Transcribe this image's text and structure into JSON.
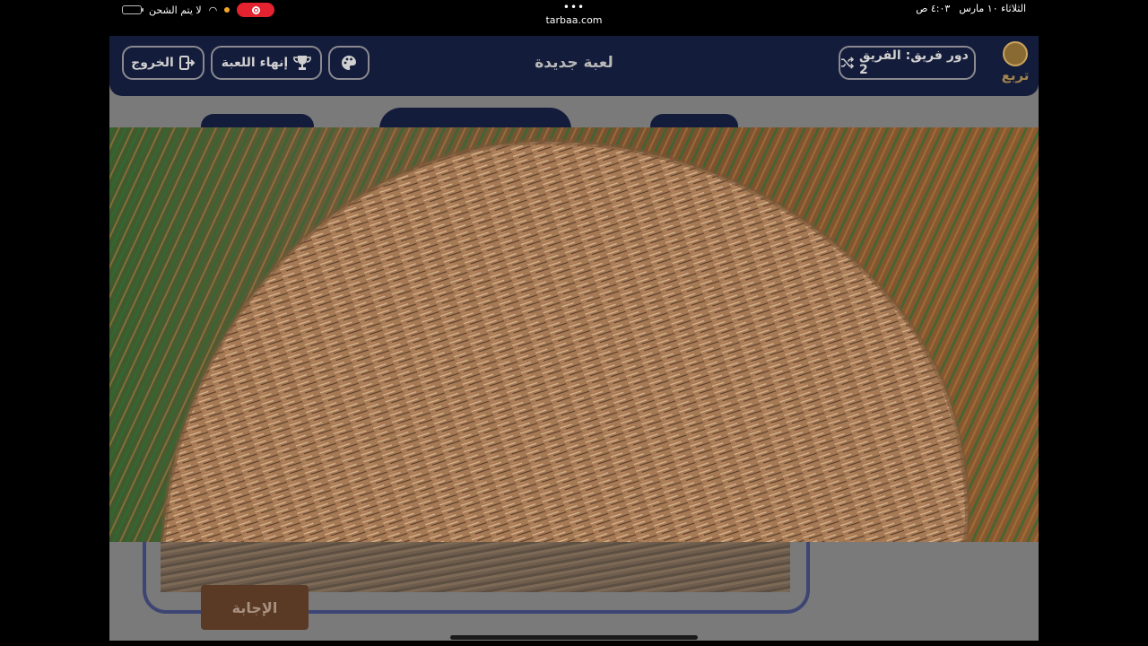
{
  "status_bar": {
    "charging_text": "لا يتم الشحن",
    "url": "tarbaa.com",
    "time": "٤:٠٣ ص",
    "date": "الثلاثاء ١٠ مارس"
  },
  "header": {
    "exit_label": "الخروج",
    "end_game_label": "إنهاء اللعبة",
    "title": "لعبة جديدة",
    "turn_label": "دور فريق: الفريق 2",
    "logo_text": "تربع"
  },
  "main": {
    "answer_label": "الإجابة"
  },
  "icons": [
    "battery-icon",
    "wifi-icon",
    "record-icon",
    "exit-icon",
    "trophy-icon",
    "palette-icon",
    "shuffle-icon"
  ],
  "colors": {
    "header_bg": "#141c3b",
    "overlay_bg": "#7a7a7a",
    "answer_bg": "#5a3a24",
    "record_red": "#e5222f"
  }
}
